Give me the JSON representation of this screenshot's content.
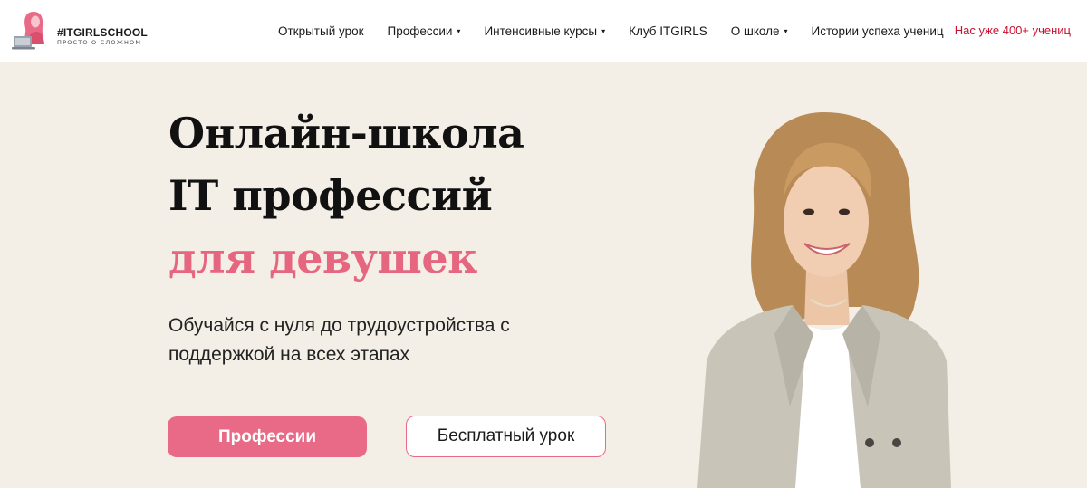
{
  "header": {
    "logo_name": "#ITGIRLSCHOOL",
    "logo_tagline": "ПРОСТО О СЛОЖНОМ",
    "nav": [
      {
        "label": "Открытый урок",
        "dropdown": false
      },
      {
        "label": "Профессии",
        "dropdown": true
      },
      {
        "label": "Интенсивные курсы",
        "dropdown": true
      },
      {
        "label": "Клуб ITGIRLS",
        "dropdown": false
      },
      {
        "label": "О школе",
        "dropdown": true
      },
      {
        "label": "Истории успеха учениц",
        "dropdown": false
      }
    ],
    "caret": "▾",
    "badge": "Нас уже 400+ учениц"
  },
  "hero": {
    "title_line1": "Онлайн-школа",
    "title_line2": "IT профессий",
    "title_line3": "для девушек",
    "subtitle": "Обучайся с нуля до трудоустройства с поддержкой на всех этапах",
    "primary_button": "Профессии",
    "secondary_button": "Бесплатный урок"
  },
  "colors": {
    "accent": "#e96a87",
    "background": "#f3eee6",
    "badge": "#c8102e"
  },
  "icons": {
    "logo_mark": "girl-with-laptop-logo-icon",
    "portrait": "smiling-woman-portrait"
  }
}
